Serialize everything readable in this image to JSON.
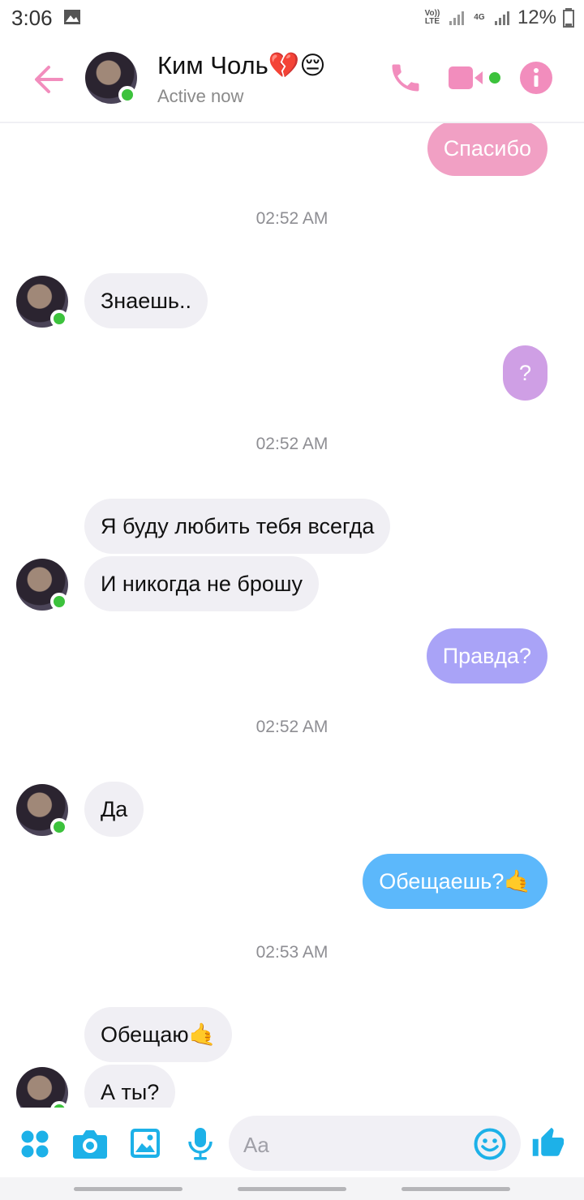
{
  "status_bar": {
    "time": "3:06",
    "network_1": "Vo)) LTE",
    "network_2": "4G",
    "battery": "12%"
  },
  "header": {
    "back_icon": "arrow-left-icon",
    "contact_name": "Ким Чоль💔😔",
    "status": "Active now",
    "accent_color": "#f28dbd"
  },
  "messages": [
    {
      "side": "out",
      "text": "Спасибо",
      "color": "#f1a0c4"
    },
    {
      "side": "time",
      "text": "02:52 AM"
    },
    {
      "side": "in",
      "text": "Знаешь.."
    },
    {
      "side": "out",
      "text": "?",
      "color": "#cf9fe5"
    },
    {
      "side": "time",
      "text": "02:52 AM"
    },
    {
      "side": "in",
      "text": "Я буду любить тебя всегда"
    },
    {
      "side": "in",
      "text": "И никогда не брошу"
    },
    {
      "side": "out",
      "text": "Правда?",
      "color": "#a9a3f7"
    },
    {
      "side": "time",
      "text": "02:52 AM"
    },
    {
      "side": "in",
      "text": "Да"
    },
    {
      "side": "out",
      "text": "Обещаешь?🤙",
      "color": "#5cb8fb"
    },
    {
      "side": "time",
      "text": "02:53 AM"
    },
    {
      "side": "in",
      "text": "Обещаю🤙"
    },
    {
      "side": "in",
      "text": "А ты?"
    }
  ],
  "composer": {
    "placeholder": "Aa",
    "icons": [
      "apps-icon",
      "camera-icon",
      "gallery-icon",
      "microphone-icon",
      "emoji-icon",
      "thumbs-up-icon"
    ],
    "icon_color": "#1db1e8"
  }
}
